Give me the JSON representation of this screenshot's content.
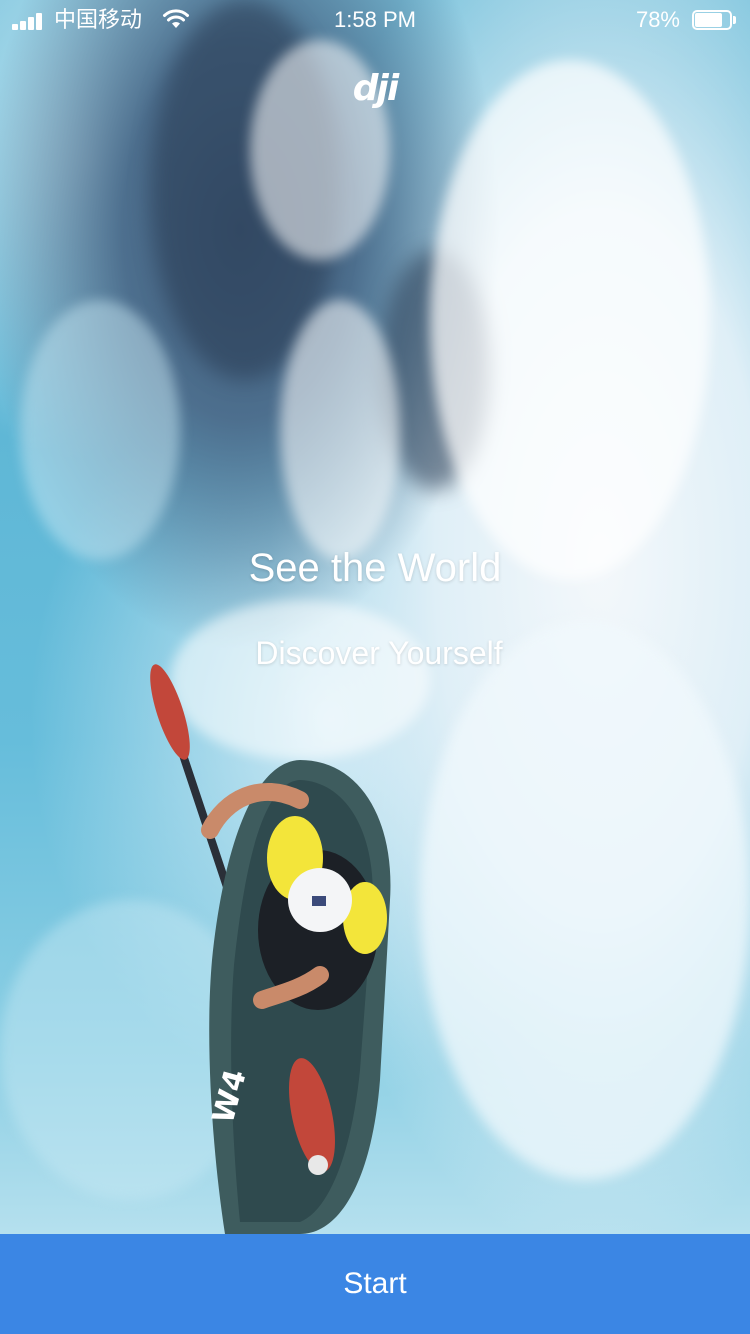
{
  "status_bar": {
    "carrier": "中国移动",
    "time": "1:58 PM",
    "battery_percent_label": "78%",
    "battery_level": 0.78,
    "signal_bars": 4
  },
  "logo": {
    "text": "dji"
  },
  "hero": {
    "headline": "See the World",
    "subheadline": "Discover Yourself",
    "image_description_icon": "kayaker-photo"
  },
  "start_button": {
    "label": "Start"
  },
  "colors": {
    "button_bg": "#3b86e4",
    "text": "#ffffff"
  },
  "icons": {
    "signal": "cellular-signal-icon",
    "wifi": "wifi-icon",
    "battery": "battery-icon"
  }
}
